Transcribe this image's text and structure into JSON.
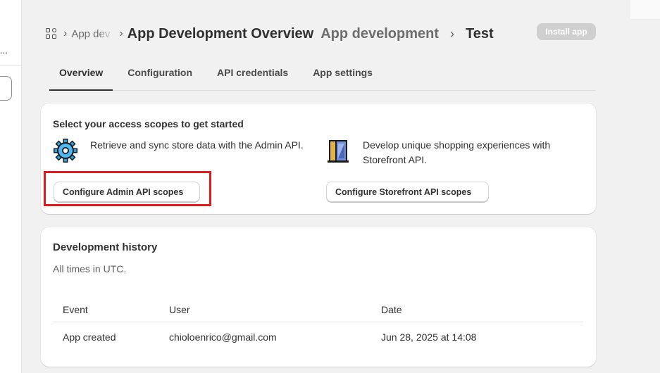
{
  "sidebar": {
    "truncated_text": "..."
  },
  "header": {
    "crumb_faded": "App dev",
    "title": "App Development Overview",
    "subtitle": "App development",
    "page": "Test",
    "install_button": "Install app"
  },
  "tabs": [
    {
      "label": "Overview",
      "active": true
    },
    {
      "label": "Configuration",
      "active": false
    },
    {
      "label": "API credentials",
      "active": false
    },
    {
      "label": "App settings",
      "active": false
    }
  ],
  "scopes_card": {
    "title": "Select your access scopes to get started",
    "admin": {
      "icon": "gear-icon",
      "text": "Retrieve and sync store data with the Admin API.",
      "button": "Configure Admin API scopes"
    },
    "storefront": {
      "icon": "storefront-icon",
      "text": "Develop unique shopping experiences with Storefront API.",
      "button": "Configure Storefront API scopes"
    },
    "highlight_color": "#e11b1b"
  },
  "history_card": {
    "title": "Development history",
    "note": "All times in UTC.",
    "columns": [
      "Event",
      "User",
      "Date"
    ],
    "rows": [
      {
        "event": "App created",
        "user": "chioloenrico@gmail.com",
        "date": "Jun 28, 2025 at 14:08"
      }
    ]
  }
}
